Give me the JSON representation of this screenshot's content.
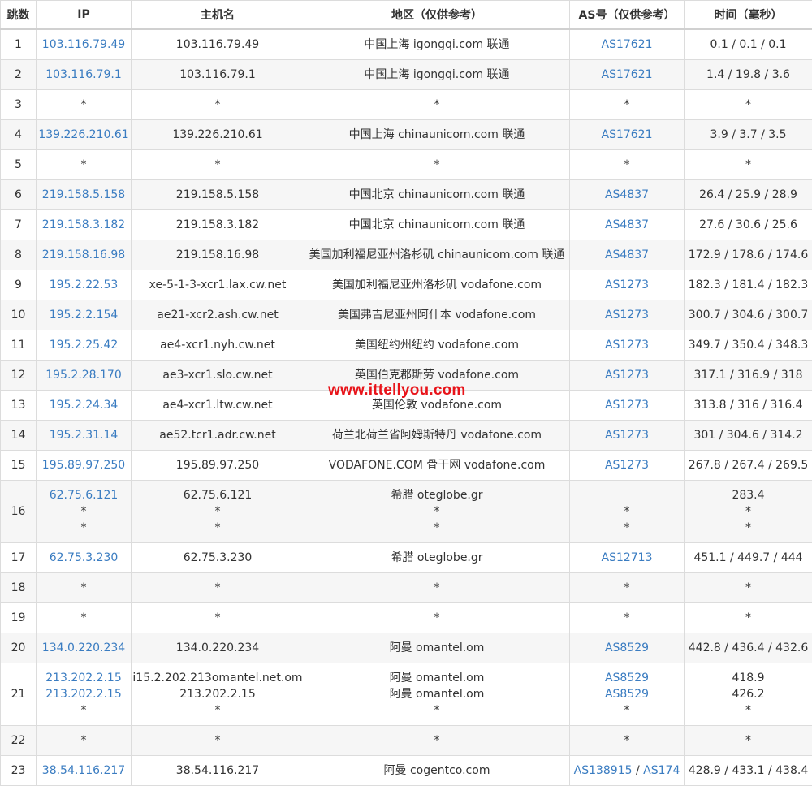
{
  "headers": [
    "跳数",
    "IP",
    "主机名",
    "地区（仅供参考）",
    "AS号（仅供参考）",
    "时间（毫秒）"
  ],
  "rows": [
    {
      "hop": "1",
      "ip": [
        "103.116.79.49"
      ],
      "host": [
        "103.116.79.49"
      ],
      "loc": [
        "中国上海 igongqi.com 联通"
      ],
      "as": [
        "AS17621"
      ],
      "time": [
        "0.1 / 0.1 / 0.1"
      ]
    },
    {
      "hop": "2",
      "ip": [
        "103.116.79.1"
      ],
      "host": [
        "103.116.79.1"
      ],
      "loc": [
        "中国上海 igongqi.com 联通"
      ],
      "as": [
        "AS17621"
      ],
      "time": [
        "1.4 / 19.8 / 3.6"
      ]
    },
    {
      "hop": "3",
      "ip": [
        "*"
      ],
      "host": [
        "*"
      ],
      "loc": [
        "*"
      ],
      "as": [
        "*"
      ],
      "time": [
        "*"
      ]
    },
    {
      "hop": "4",
      "ip": [
        "139.226.210.61"
      ],
      "host": [
        "139.226.210.61"
      ],
      "loc": [
        "中国上海 chinaunicom.com 联通"
      ],
      "as": [
        "AS17621"
      ],
      "time": [
        "3.9 / 3.7 / 3.5"
      ]
    },
    {
      "hop": "5",
      "ip": [
        "*"
      ],
      "host": [
        "*"
      ],
      "loc": [
        "*"
      ],
      "as": [
        "*"
      ],
      "time": [
        "*"
      ]
    },
    {
      "hop": "6",
      "ip": [
        "219.158.5.158"
      ],
      "host": [
        "219.158.5.158"
      ],
      "loc": [
        "中国北京 chinaunicom.com 联通"
      ],
      "as": [
        "AS4837"
      ],
      "time": [
        "26.4 / 25.9 / 28.9"
      ]
    },
    {
      "hop": "7",
      "ip": [
        "219.158.3.182"
      ],
      "host": [
        "219.158.3.182"
      ],
      "loc": [
        "中国北京 chinaunicom.com 联通"
      ],
      "as": [
        "AS4837"
      ],
      "time": [
        "27.6 / 30.6 / 25.6"
      ]
    },
    {
      "hop": "8",
      "ip": [
        "219.158.16.98"
      ],
      "host": [
        "219.158.16.98"
      ],
      "loc": [
        "美国加利福尼亚州洛杉矶 chinaunicom.com 联通"
      ],
      "as": [
        "AS4837"
      ],
      "time": [
        "172.9 / 178.6 / 174.6"
      ]
    },
    {
      "hop": "9",
      "ip": [
        "195.2.22.53"
      ],
      "host": [
        "xe-5-1-3-xcr1.lax.cw.net"
      ],
      "loc": [
        "美国加利福尼亚州洛杉矶 vodafone.com"
      ],
      "as": [
        "AS1273"
      ],
      "time": [
        "182.3 / 181.4 / 182.3"
      ]
    },
    {
      "hop": "10",
      "ip": [
        "195.2.2.154"
      ],
      "host": [
        "ae21-xcr2.ash.cw.net"
      ],
      "loc": [
        "美国弗吉尼亚州阿什本 vodafone.com"
      ],
      "as": [
        "AS1273"
      ],
      "time": [
        "300.7 / 304.6 / 300.7"
      ]
    },
    {
      "hop": "11",
      "ip": [
        "195.2.25.42"
      ],
      "host": [
        "ae4-xcr1.nyh.cw.net"
      ],
      "loc": [
        "美国纽约州纽约 vodafone.com"
      ],
      "as": [
        "AS1273"
      ],
      "time": [
        "349.7 / 350.4 / 348.3"
      ]
    },
    {
      "hop": "12",
      "ip": [
        "195.2.28.170"
      ],
      "host": [
        "ae3-xcr1.slo.cw.net"
      ],
      "loc": [
        "英国伯克郡斯劳 vodafone.com"
      ],
      "as": [
        "AS1273"
      ],
      "time": [
        "317.1 / 316.9 / 318"
      ]
    },
    {
      "hop": "13",
      "ip": [
        "195.2.24.34"
      ],
      "host": [
        "ae4-xcr1.ltw.cw.net"
      ],
      "loc": [
        "英国伦敦 vodafone.com"
      ],
      "as": [
        "AS1273"
      ],
      "time": [
        "313.8 / 316 / 316.4"
      ]
    },
    {
      "hop": "14",
      "ip": [
        "195.2.31.14"
      ],
      "host": [
        "ae52.tcr1.adr.cw.net"
      ],
      "loc": [
        "荷兰北荷兰省阿姆斯特丹 vodafone.com"
      ],
      "as": [
        "AS1273"
      ],
      "time": [
        "301 / 304.6 / 314.2"
      ]
    },
    {
      "hop": "15",
      "ip": [
        "195.89.97.250"
      ],
      "host": [
        "195.89.97.250"
      ],
      "loc": [
        "VODAFONE.COM 骨干网 vodafone.com"
      ],
      "as": [
        "AS1273"
      ],
      "time": [
        "267.8 / 267.4 / 269.5"
      ]
    },
    {
      "hop": "16",
      "ip": [
        "62.75.6.121",
        "*",
        "*"
      ],
      "host": [
        "62.75.6.121",
        "*",
        "*"
      ],
      "loc": [
        "希腊 oteglobe.gr",
        "*",
        "*"
      ],
      "as": [
        "",
        "*",
        "*"
      ],
      "time": [
        "283.4",
        "*",
        "*"
      ]
    },
    {
      "hop": "17",
      "ip": [
        "62.75.3.230"
      ],
      "host": [
        "62.75.3.230"
      ],
      "loc": [
        "希腊 oteglobe.gr"
      ],
      "as": [
        "AS12713"
      ],
      "time": [
        "451.1 / 449.7 / 444"
      ]
    },
    {
      "hop": "18",
      "ip": [
        "*"
      ],
      "host": [
        "*"
      ],
      "loc": [
        "*"
      ],
      "as": [
        "*"
      ],
      "time": [
        "*"
      ]
    },
    {
      "hop": "19",
      "ip": [
        "*"
      ],
      "host": [
        "*"
      ],
      "loc": [
        "*"
      ],
      "as": [
        "*"
      ],
      "time": [
        "*"
      ]
    },
    {
      "hop": "20",
      "ip": [
        "134.0.220.234"
      ],
      "host": [
        "134.0.220.234"
      ],
      "loc": [
        "阿曼 omantel.om"
      ],
      "as": [
        "AS8529"
      ],
      "time": [
        "442.8 / 436.4 / 432.6"
      ]
    },
    {
      "hop": "21",
      "ip": [
        "213.202.2.15",
        "213.202.2.15",
        "*"
      ],
      "host": [
        "i15.2.202.213omantel.net.om",
        "213.202.2.15",
        "*"
      ],
      "loc": [
        "阿曼 omantel.om",
        "阿曼 omantel.om",
        "*"
      ],
      "as": [
        "AS8529",
        "AS8529",
        "*"
      ],
      "time": [
        "418.9",
        "426.2",
        "*"
      ]
    },
    {
      "hop": "22",
      "ip": [
        "*"
      ],
      "host": [
        "*"
      ],
      "loc": [
        "*"
      ],
      "as": [
        "*"
      ],
      "time": [
        "*"
      ]
    },
    {
      "hop": "23",
      "ip": [
        "38.54.116.217"
      ],
      "host": [
        "38.54.116.217"
      ],
      "loc": [
        "阿曼 cogentco.com"
      ],
      "as": [
        "AS138915 / AS174"
      ],
      "time": [
        "428.9 / 433.1 / 438.4"
      ]
    }
  ],
  "watermark": "www.ittellyou.com",
  "colors": {
    "link": "#3a7cc1",
    "watermark": "#e8141a",
    "stripe": "#f6f6f6",
    "border": "#dcdcdc"
  }
}
